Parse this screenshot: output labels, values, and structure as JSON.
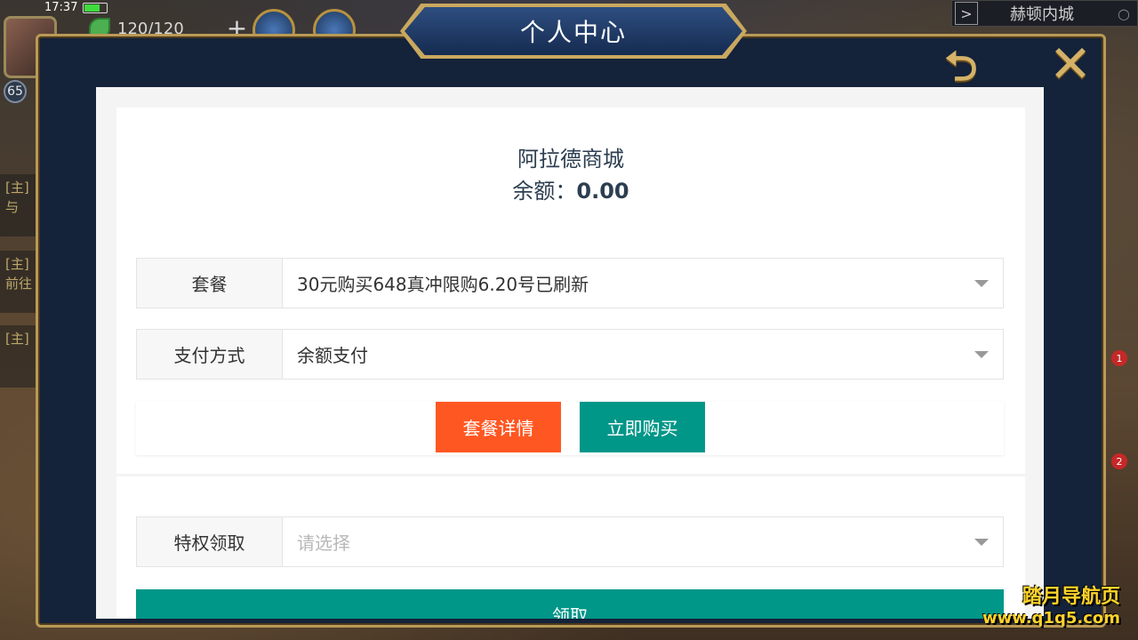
{
  "game_hud": {
    "time": "17:37",
    "stamina": "120/120",
    "level": "65",
    "city_name": "赫顿内城",
    "city_arrow": ">",
    "quest_labels": [
      "[主]",
      "与",
      "[主]",
      "前往",
      "[主]"
    ],
    "badges": [
      "1",
      "2"
    ]
  },
  "dialog": {
    "title": "个人中心",
    "back_icon": "back-arrow-icon",
    "close_icon": "close-x-icon"
  },
  "shop": {
    "name": "阿拉德商城",
    "balance_label": "余额：",
    "balance_value": "0.00",
    "package_label": "套餐",
    "package_value": "30元购买648真冲限购6.20号已刷新",
    "payment_label": "支付方式",
    "payment_value": "余额支付",
    "detail_button": "套餐详情",
    "buy_button": "立即购买",
    "privilege_label": "特权领取",
    "privilege_placeholder": "请选择",
    "claim_button": "领取"
  },
  "watermark": {
    "line1": "踏月导航页",
    "line2": "www.q1q5.com"
  },
  "colors": {
    "orange": "#ff5722",
    "teal": "#009688",
    "dialog_bg": "#14223a",
    "gold": "#c9a85f"
  }
}
